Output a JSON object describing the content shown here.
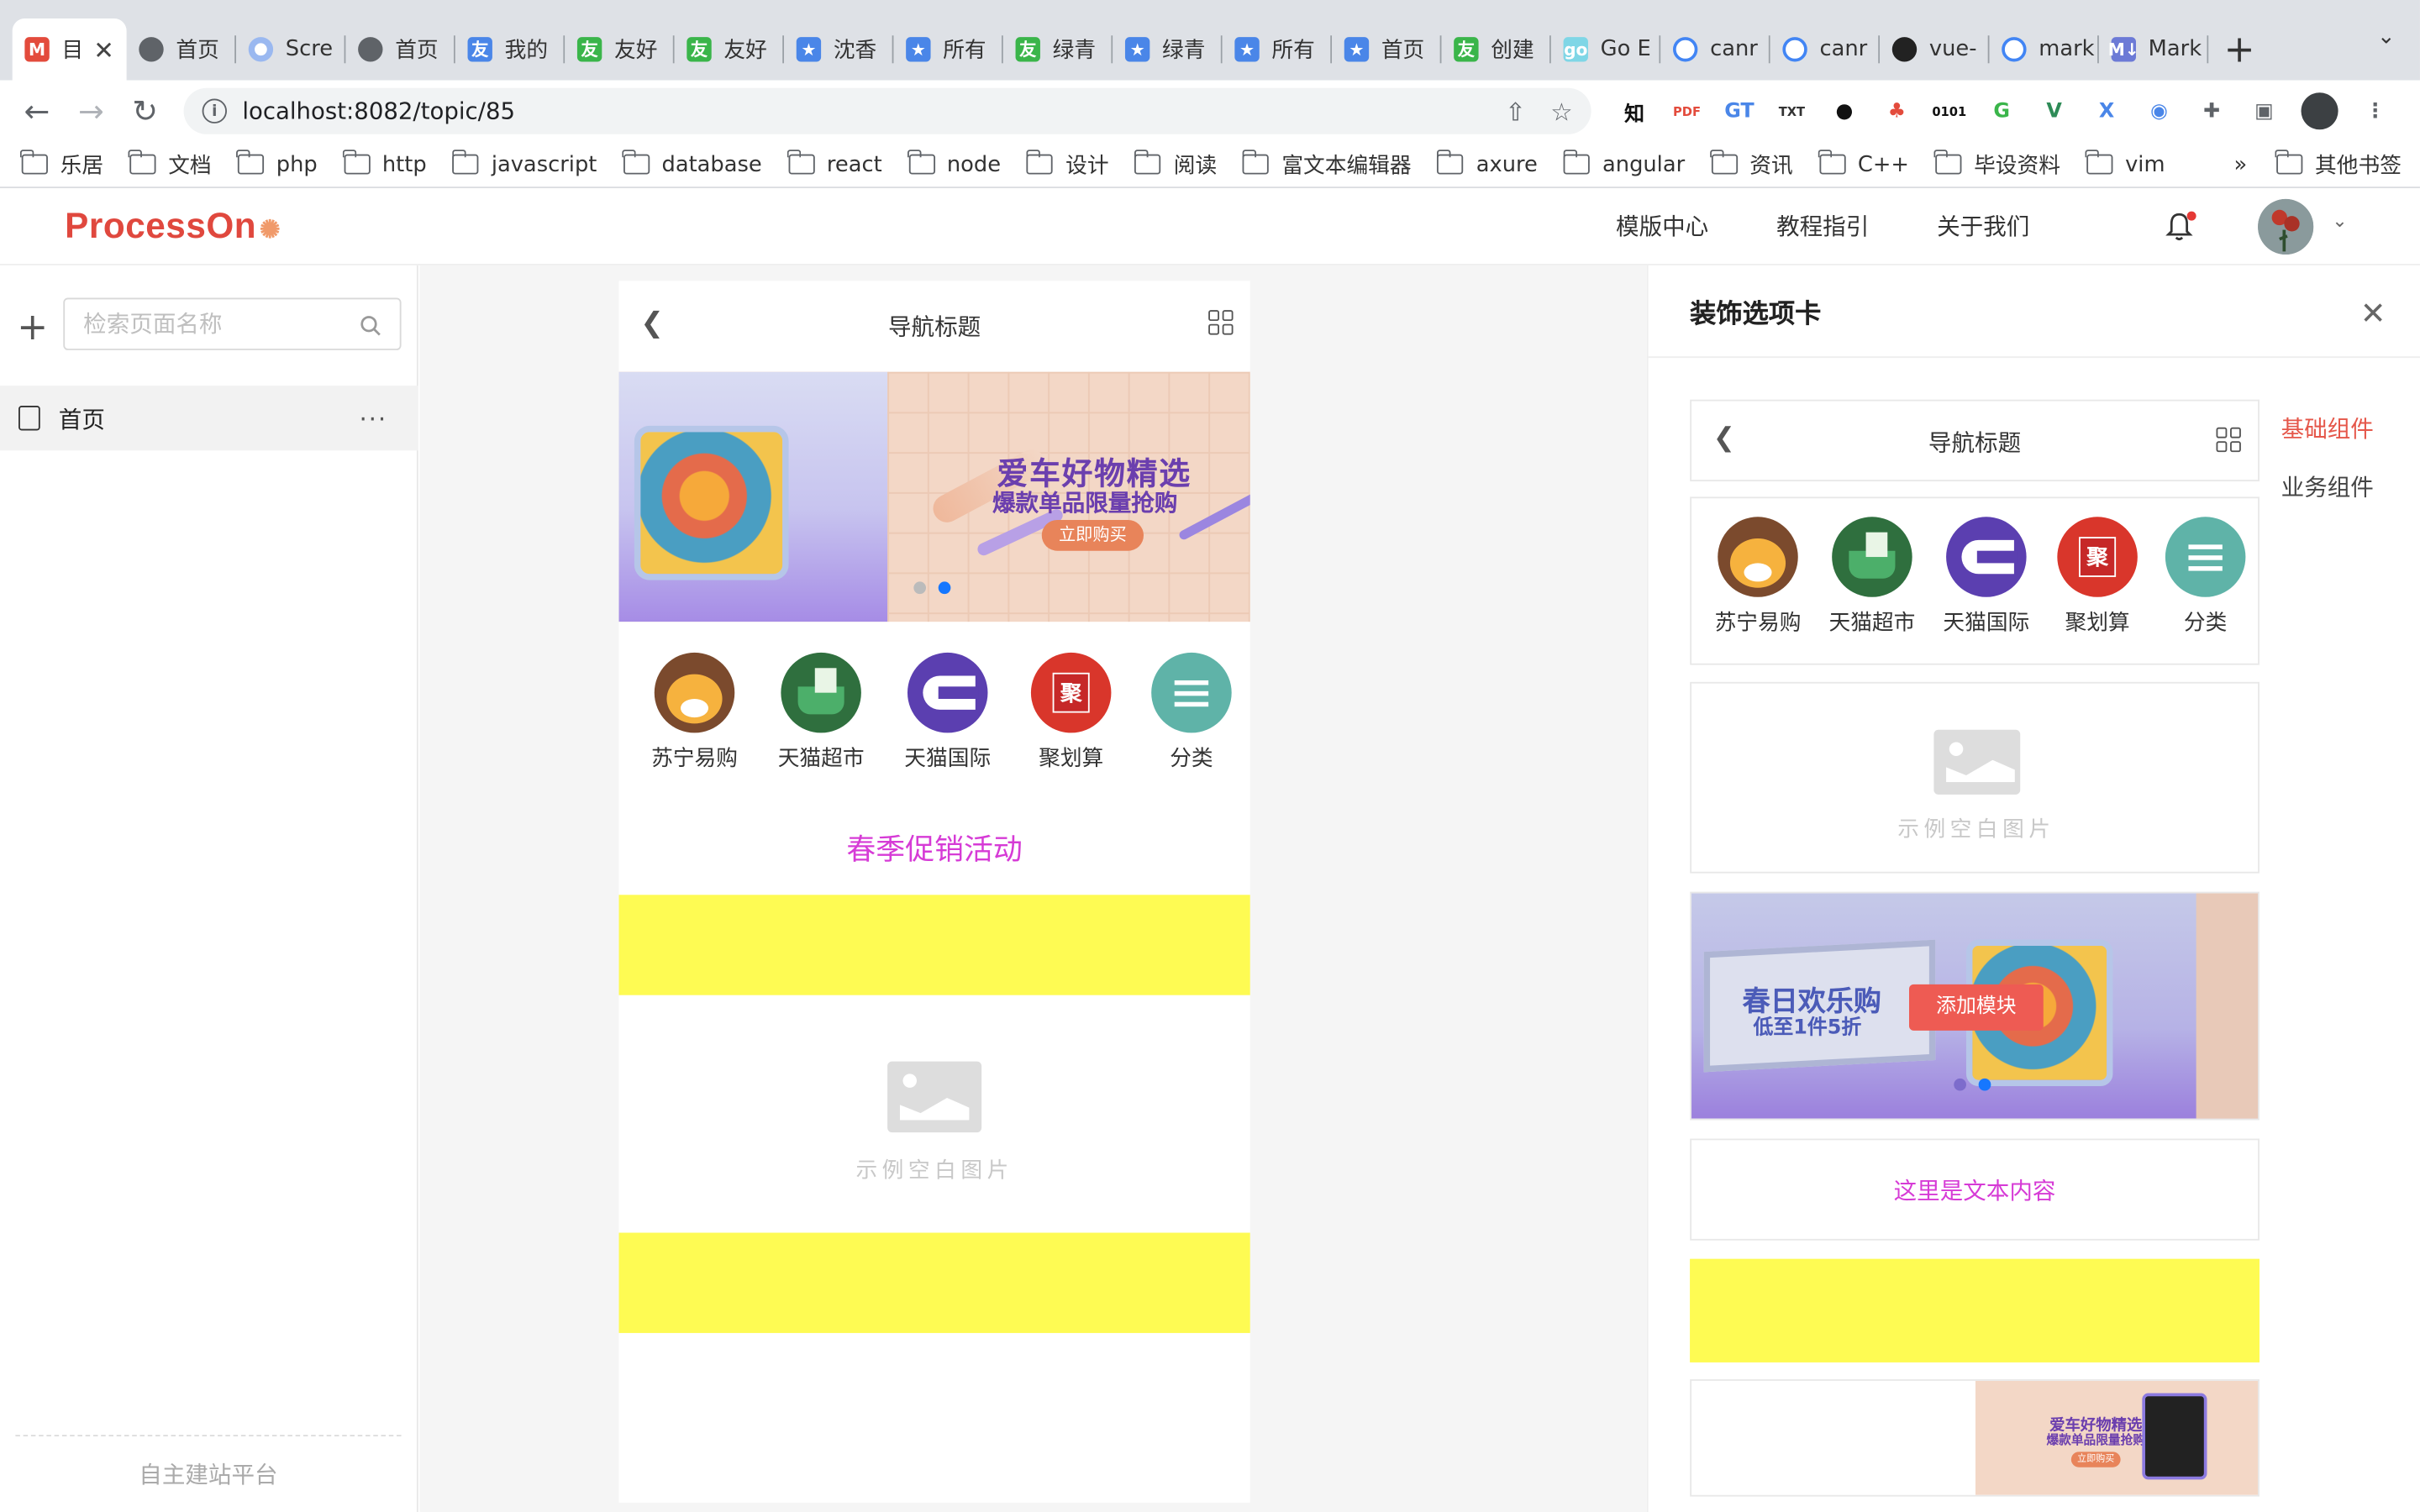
{
  "browser": {
    "tabs": [
      {
        "label": "目",
        "favicon": "M",
        "color": "#e34b3c",
        "active": true
      },
      {
        "label": "首页",
        "favicon": "globe",
        "color": "#5f6368"
      },
      {
        "label": "Scre",
        "favicon": "chrome",
        "color": "#4a86e8"
      },
      {
        "label": "首页",
        "favicon": "globe",
        "color": "#5f6368"
      },
      {
        "label": "我的",
        "favicon": "友",
        "color": "#4a86e8"
      },
      {
        "label": "友好",
        "favicon": "友",
        "color": "#3ab54a"
      },
      {
        "label": "友好",
        "favicon": "友",
        "color": "#3ab54a"
      },
      {
        "label": "沈香",
        "favicon": "★",
        "color": "#4a86e8"
      },
      {
        "label": "所有",
        "favicon": "★",
        "color": "#4a86e8"
      },
      {
        "label": "绿青",
        "favicon": "友",
        "color": "#3ab54a"
      },
      {
        "label": "绿青",
        "favicon": "★",
        "color": "#4a86e8"
      },
      {
        "label": "所有",
        "favicon": "★",
        "color": "#4a86e8"
      },
      {
        "label": "首页",
        "favicon": "★",
        "color": "#4a86e8"
      },
      {
        "label": "创建",
        "favicon": "友",
        "color": "#3ab54a"
      },
      {
        "label": "Go E",
        "favicon": "go",
        "color": "#7fd6e6"
      },
      {
        "label": "canr",
        "favicon": "G",
        "color": "#ffffff"
      },
      {
        "label": "canr",
        "favicon": "G",
        "color": "#ffffff"
      },
      {
        "label": "vue-",
        "favicon": "gh",
        "color": "#222222"
      },
      {
        "label": "mark",
        "favicon": "G",
        "color": "#ffffff"
      },
      {
        "label": "Mark",
        "favicon": "M↓",
        "color": "#6c7ad6"
      }
    ],
    "url": "localhost:8082/topic/85",
    "bookmarks": [
      "乐居",
      "文档",
      "php",
      "http",
      "javascript",
      "database",
      "react",
      "node",
      "设计",
      "阅读",
      "富文本编辑器",
      "axure",
      "angular",
      "资讯",
      "C++",
      "毕设资料",
      "vim"
    ],
    "bookmarks_more": "»",
    "other_bookmarks": "其他书签",
    "extensions": [
      "知",
      "PDF",
      "GT",
      "TXT",
      "●",
      "♣",
      "0101",
      "G",
      "V",
      "X",
      "◉"
    ]
  },
  "header": {
    "logo": "ProcessOn",
    "nav": [
      "模版中心",
      "教程指引",
      "关于我们"
    ]
  },
  "left": {
    "search_placeholder": "检索页面名称",
    "pages": [
      {
        "label": "首页"
      }
    ],
    "more": "···",
    "footer": "自主建站平台"
  },
  "phone": {
    "nav_title": "导航标题",
    "banner": {
      "line1": "爱车好物精选",
      "line2": "爆款单品限量抢购",
      "button": "立即购买"
    },
    "icons": [
      {
        "label": "苏宁易购",
        "icon": "suning-icon"
      },
      {
        "label": "天猫超市",
        "icon": "tmall-market-icon"
      },
      {
        "label": "天猫国际",
        "icon": "tmall-intl-icon"
      },
      {
        "label": "聚划算",
        "icon": "juhuasuan-icon",
        "glyph": "聚"
      },
      {
        "label": "分类",
        "icon": "category-icon"
      }
    ],
    "promo_text": "春季促销活动",
    "image_placeholder": "示例空白图片",
    "accent_text_color": "#d63bd6",
    "block_color": "#fefb53"
  },
  "right": {
    "title": "装饰选项卡",
    "categories": [
      {
        "label": "基础组件",
        "active": true
      },
      {
        "label": "业务组件",
        "active": false
      }
    ],
    "nav_title": "导航标题",
    "icons": [
      "苏宁易购",
      "天猫超市",
      "天猫国际",
      "聚划算",
      "分类"
    ],
    "image_placeholder": "示例空白图片",
    "banner": {
      "line1": "春日欢乐购",
      "line2": "低至1件5折"
    },
    "add_module": "添加模块",
    "text_content": "这里是文本内容",
    "mini_banner": {
      "line1": "爱车好物精选",
      "line2": "爆款单品限量抢购",
      "button": "立即购买"
    }
  }
}
